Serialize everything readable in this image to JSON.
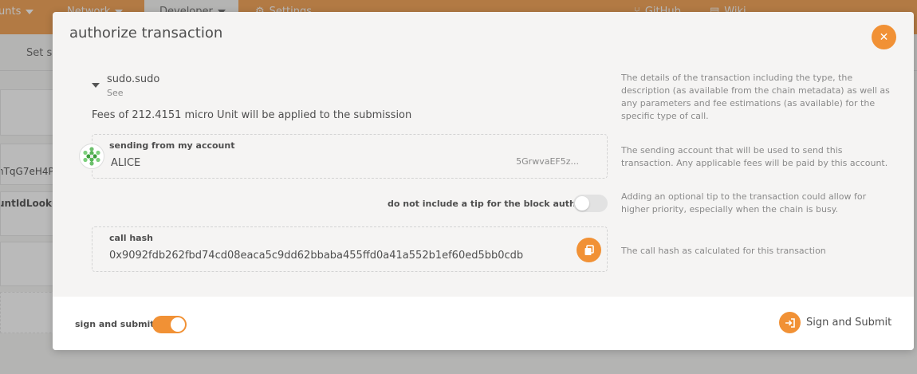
{
  "nav": {
    "accounts": "unts",
    "network": "Network",
    "developer": "Developer",
    "settings": "Settings",
    "github": "GitHub",
    "wiki": "Wiki"
  },
  "background": {
    "subbar_text": "Set su",
    "row_text_1": "nTqG7eH4P",
    "row_text_2": "untIdLooku"
  },
  "modal": {
    "title": "authorize transaction",
    "close_icon": "close-icon",
    "call": {
      "name": "sudo.sudo",
      "see": "See",
      "fees": "Fees of 212.4151 micro Unit will be applied to the submission",
      "help": "The details of the transaction including the type, the description (as available from the chain metadata) as well as any parameters and fee estimations (as available) for the specific type of call."
    },
    "account": {
      "label": "sending from my account",
      "name": "ALICE",
      "address": "5GrwvaEF5z...",
      "help": "The sending account that will be used to send this transaction. Any applicable fees will be paid by this account."
    },
    "tip": {
      "label": "do not include a tip for the block author",
      "enabled": false,
      "help": "Adding an optional tip to the transaction could allow for higher priority, especially when the chain is busy."
    },
    "call_hash": {
      "label": "call hash",
      "value": "0x9092fdb262fbd74cd08eaca5c9dd62bbaba455ffd0a41a552b1ef60ed5bb0cdb",
      "help": "The call hash as calculated for this transaction",
      "copy_icon": "copy-icon"
    },
    "footer": {
      "sign_label": "sign and submit",
      "sign_enabled": true,
      "submit_label": "Sign and Submit"
    }
  },
  "colors": {
    "accent": "#f19135",
    "modal_bg": "#f5f4f3",
    "text": "#4e4e4e",
    "muted": "#8a8a8a"
  }
}
